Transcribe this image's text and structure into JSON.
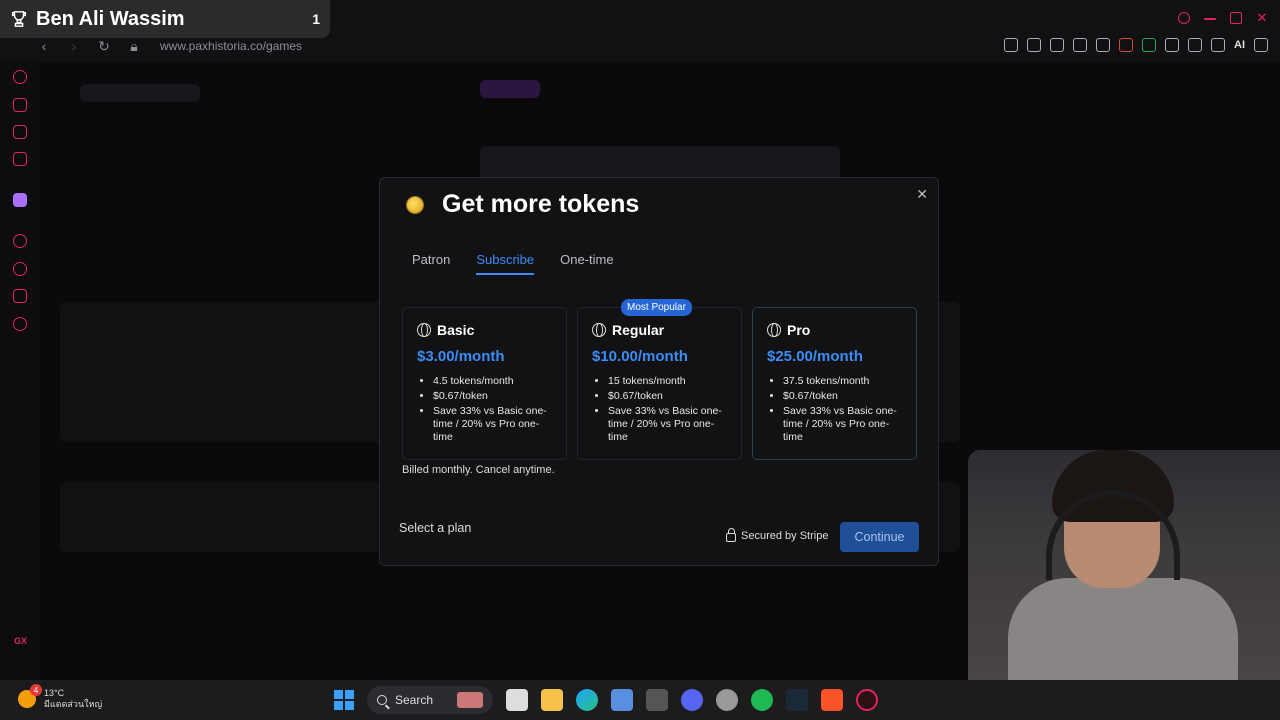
{
  "overlay": {
    "streamer_name": "Ben Ali Wassim",
    "count": "1"
  },
  "browser": {
    "url": "www.paxhistoria.co/games",
    "ai_label": "AI"
  },
  "modal": {
    "title": "Get more tokens",
    "tabs": [
      {
        "label": "Patron"
      },
      {
        "label": "Subscribe"
      },
      {
        "label": "One-time"
      }
    ],
    "plans": [
      {
        "name": "Basic",
        "price": "$3.00/month",
        "features": [
          "4.5 tokens/month",
          "$0.67/token",
          "Save 33% vs Basic one-time / 20% vs Pro one-time"
        ]
      },
      {
        "name": "Regular",
        "price": "$10.00/month",
        "badge": "Most Popular",
        "features": [
          "15 tokens/month",
          "$0.67/token",
          "Save 33% vs Basic one-time / 20% vs Pro one-time"
        ]
      },
      {
        "name": "Pro",
        "price": "$25.00/month",
        "features": [
          "37.5 tokens/month",
          "$0.67/token",
          "Save 33% vs Basic one-time / 20% vs Pro one-time"
        ]
      }
    ],
    "billing_note": "Billed monthly. Cancel anytime.",
    "select_prompt": "Select a plan",
    "secured": "Secured by Stripe",
    "continue_label": "Continue"
  },
  "taskbar": {
    "temperature": "13°C",
    "weather_desc": "มีแดดส่วนใหญ่",
    "weather_badge": "4",
    "search_label": "Search"
  },
  "colors": {
    "accent": "#3b8cf6",
    "brand_red": "#e0245e",
    "bg": "#0b0b0d"
  }
}
